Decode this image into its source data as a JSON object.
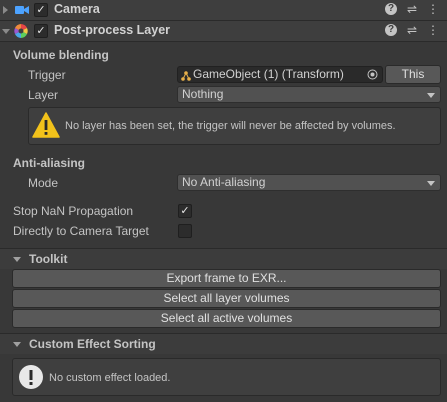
{
  "camera": {
    "title": "Camera"
  },
  "ppl": {
    "title": "Post-process Layer"
  },
  "volume": {
    "heading": "Volume blending",
    "trigger_label": "Trigger",
    "trigger_value": "GameObject (1) (Transform)",
    "this_button": "This",
    "layer_label": "Layer",
    "layer_value": "Nothing",
    "warning": "No layer has been set, the trigger will never be affected by volumes."
  },
  "aa": {
    "heading": "Anti-aliasing",
    "mode_label": "Mode",
    "mode_value": "No Anti-aliasing"
  },
  "options": {
    "stop_nan_label": "Stop NaN Propagation",
    "stop_nan_checked": true,
    "direct_label": "Directly to Camera Target",
    "direct_checked": false
  },
  "toolkit": {
    "title": "Toolkit",
    "buttons": [
      "Export frame to EXR...",
      "Select all layer volumes",
      "Select all active volumes"
    ]
  },
  "custom": {
    "title": "Custom Effect Sorting",
    "message": "No custom effect loaded."
  },
  "icons": {
    "help": "help-icon",
    "presets": "presets-icon",
    "menu": "kebab-menu-icon"
  }
}
